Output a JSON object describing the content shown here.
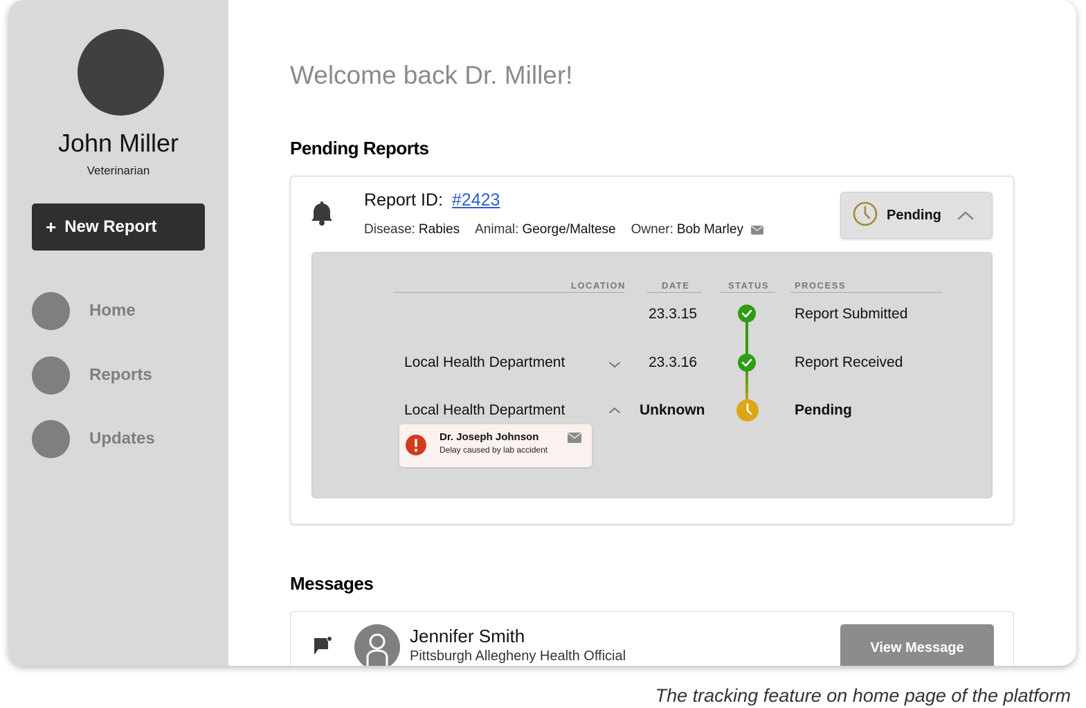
{
  "sidebar": {
    "user_name": "John Miller",
    "user_role": "Veterinarian",
    "new_report_plus": "+",
    "new_report_label": "New Report",
    "nav": [
      {
        "label": "Home"
      },
      {
        "label": "Reports"
      },
      {
        "label": "Updates"
      }
    ]
  },
  "main": {
    "welcome": "Welcome back Dr. Miller!",
    "pending_title": "Pending Reports",
    "report": {
      "id_label": "Report ID:",
      "id_value": "#2423",
      "disease_label": "Disease:",
      "disease_value": "Rabies",
      "animal_label": "Animal:",
      "animal_value": "George/Maltese",
      "owner_label": "Owner:",
      "owner_value": "Bob Marley",
      "status": "Pending",
      "tracking": {
        "headers": {
          "location": "LOCATION",
          "date": "DATE",
          "status": "STATUS",
          "process": "PROCESS"
        },
        "rows": [
          {
            "location": "",
            "date": "23.3.15",
            "process": "Report Submitted",
            "state": "done"
          },
          {
            "location": "Local Health Department",
            "date": "23.3.16",
            "process": "Report Received",
            "state": "done"
          },
          {
            "location": "Local Health Department",
            "date": "Unknown",
            "process": "Pending",
            "state": "pending"
          }
        ],
        "alert": {
          "name": "Dr. Joseph Johnson",
          "message": "Delay caused by lab accident"
        }
      }
    },
    "messages_title": "Messages",
    "message": {
      "name": "Jennifer Smith",
      "subtitle": "Pittsburgh Allegheny Health Official",
      "button": "View Message"
    }
  },
  "caption": "The tracking feature on home page of the platform",
  "colors": {
    "done": "#2e9c14",
    "pending": "#dba716",
    "link": "#2a5fd1",
    "alert": "#d43a1c"
  }
}
